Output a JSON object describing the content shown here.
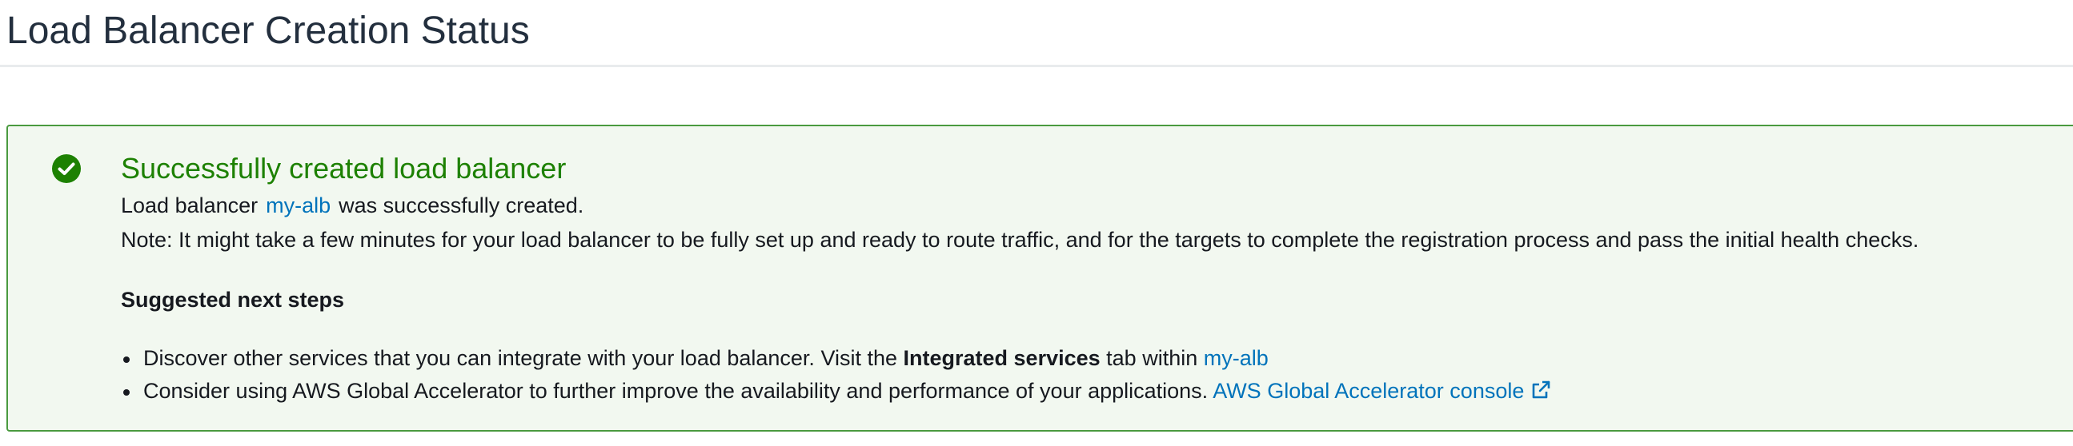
{
  "header": {
    "title": "Load Balancer Creation Status"
  },
  "alert": {
    "icon": "check-circle-icon",
    "heading": "Successfully created load balancer",
    "line1": {
      "prefix": "Load balancer",
      "link": "my-alb",
      "suffix": "was successfully created."
    },
    "note": "Note: It might take a few minutes for your load balancer to be fully set up and ready to route traffic, and for the targets to complete the registration process and pass the initial health checks.",
    "steps_heading": "Suggested next steps",
    "steps": [
      {
        "text": "Discover other services that you can integrate with your load balancer. Visit the",
        "bold": "Integrated services",
        "text2": "tab within",
        "link": "my-alb"
      },
      {
        "text": "Consider using AWS Global Accelerator to further improve the availability and performance of your applications.",
        "link": "AWS Global Accelerator console",
        "link_icon": "external-link-icon"
      }
    ]
  },
  "colors": {
    "success_green": "#1d8102",
    "alert_border": "#4a9a3f",
    "alert_background": "#f2f8f0",
    "link_blue": "#0073bb"
  }
}
